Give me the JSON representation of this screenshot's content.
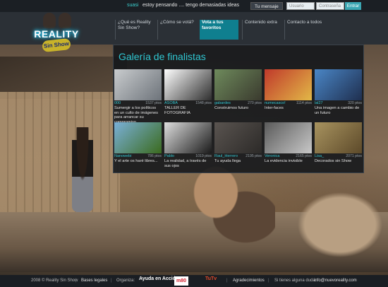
{
  "topbar": {
    "username": "suasi",
    "status": "estoy pensando .... tengo demasiadas ideas",
    "message_button": "Tu mensaje",
    "user_placeholder": "Usuario",
    "password_placeholder": "Contraseña",
    "enter_button": "Entrar"
  },
  "logo": {
    "line1": "REALITY",
    "line2": "Sin Show"
  },
  "nav": [
    {
      "label": "¿Qué es Reality Sin Show?"
    },
    {
      "label": "¿Cómo se votá?"
    },
    {
      "label": "Vota a tus favoritos"
    },
    {
      "label": "Contenido extra"
    },
    {
      "label": "Contacto a todos"
    }
  ],
  "gallery": {
    "title": "Galería de finalistas",
    "cards": [
      {
        "author": "000",
        "count": "1537 ptos",
        "title": "Sumergir a los políticos en un culto de imágenes para arrancar su compromiso",
        "colors": [
          "#c9ccce",
          "#6d737a"
        ]
      },
      {
        "author": "ASOBA",
        "count": "1548 ptos",
        "title": "TALLER DE FOTOGRAFIA",
        "colors": [
          "#ffffff",
          "#2e2e2e"
        ]
      },
      {
        "author": "gabardes",
        "count": "270 ptos",
        "title": "Construimos futuro",
        "colors": [
          "#6e8a5c",
          "#3a3a2e"
        ]
      },
      {
        "author": "numecasco!",
        "count": "1114 ptos",
        "title": "Inter-faces",
        "colors": [
          "#c0392b",
          "#e2b847"
        ]
      },
      {
        "author": "lal27",
        "count": "320 ptos",
        "title": "Una imagen a cambio de un futuro",
        "colors": [
          "#4a86c6",
          "#1f2f4f"
        ]
      },
      {
        "author": "Nanowebi",
        "count": "786 ptos",
        "title": "Y el arte os haré libres...",
        "colors": [
          "#7ab0d8",
          "#3b6b1e"
        ]
      },
      {
        "author": "Pablo",
        "count": "1019 ptos",
        "title": "La realidad, a través de sus ojos",
        "colors": [
          "#dedede",
          "#1a1a1a"
        ]
      },
      {
        "author": "Raul_Herrero",
        "count": "2195 ptos",
        "title": "Tu ayuda llega",
        "colors": [
          "#5a5450",
          "#2c2a28"
        ]
      },
      {
        "author": "Veronica",
        "count": "2165 ptos",
        "title": "La evidencia invisible",
        "colors": [
          "#5a5a5a",
          "#c8c8c8"
        ]
      },
      {
        "author": "Lisa_",
        "count": "2071 ptos",
        "title": "Decorados sin Show",
        "colors": [
          "#a8935f",
          "#5d4a2a"
        ]
      }
    ]
  },
  "footer": {
    "copyright": "2008 © Reality Sin Show",
    "legal": "Bases legales",
    "organiza": "Organiza:",
    "org1": "Ayuda en Acción",
    "org2": "m80",
    "org3": "TuTv",
    "thanks": "Agradecimientos",
    "help": "Si tienes alguna duda:",
    "email": "info@nuevoreality.com"
  }
}
